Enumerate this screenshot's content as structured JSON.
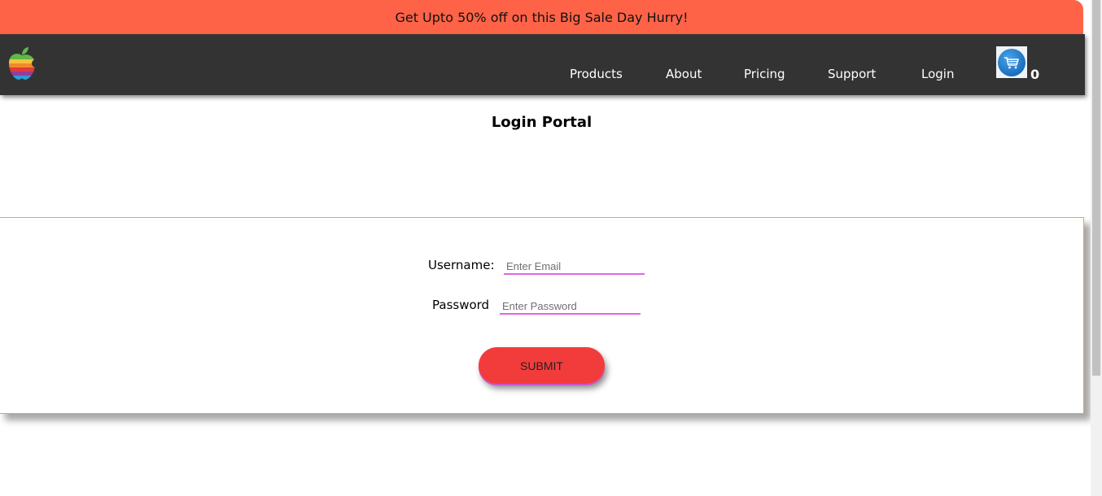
{
  "banner": {
    "text": "Get Upto 50% off on this Big Sale Day Hurry!"
  },
  "navbar": {
    "logo_icon": "apple-rainbow-logo-icon",
    "items": [
      {
        "label": "Products"
      },
      {
        "label": "About"
      },
      {
        "label": "Pricing"
      },
      {
        "label": "Support"
      },
      {
        "label": "Login"
      }
    ],
    "cart": {
      "icon": "shopping-cart-icon",
      "count": "0"
    }
  },
  "main": {
    "title": "Login Portal",
    "form": {
      "username_label": "Username:",
      "username_placeholder": "Enter Email",
      "password_label": "Password",
      "password_placeholder": "Enter Password",
      "submit_label": "SUBMIT"
    }
  },
  "colors": {
    "banner": "#ff6347",
    "navbar": "#333333",
    "card_border": "#e0b020",
    "input_underline": "#e066e0",
    "submit_button": "#f23c3c"
  }
}
